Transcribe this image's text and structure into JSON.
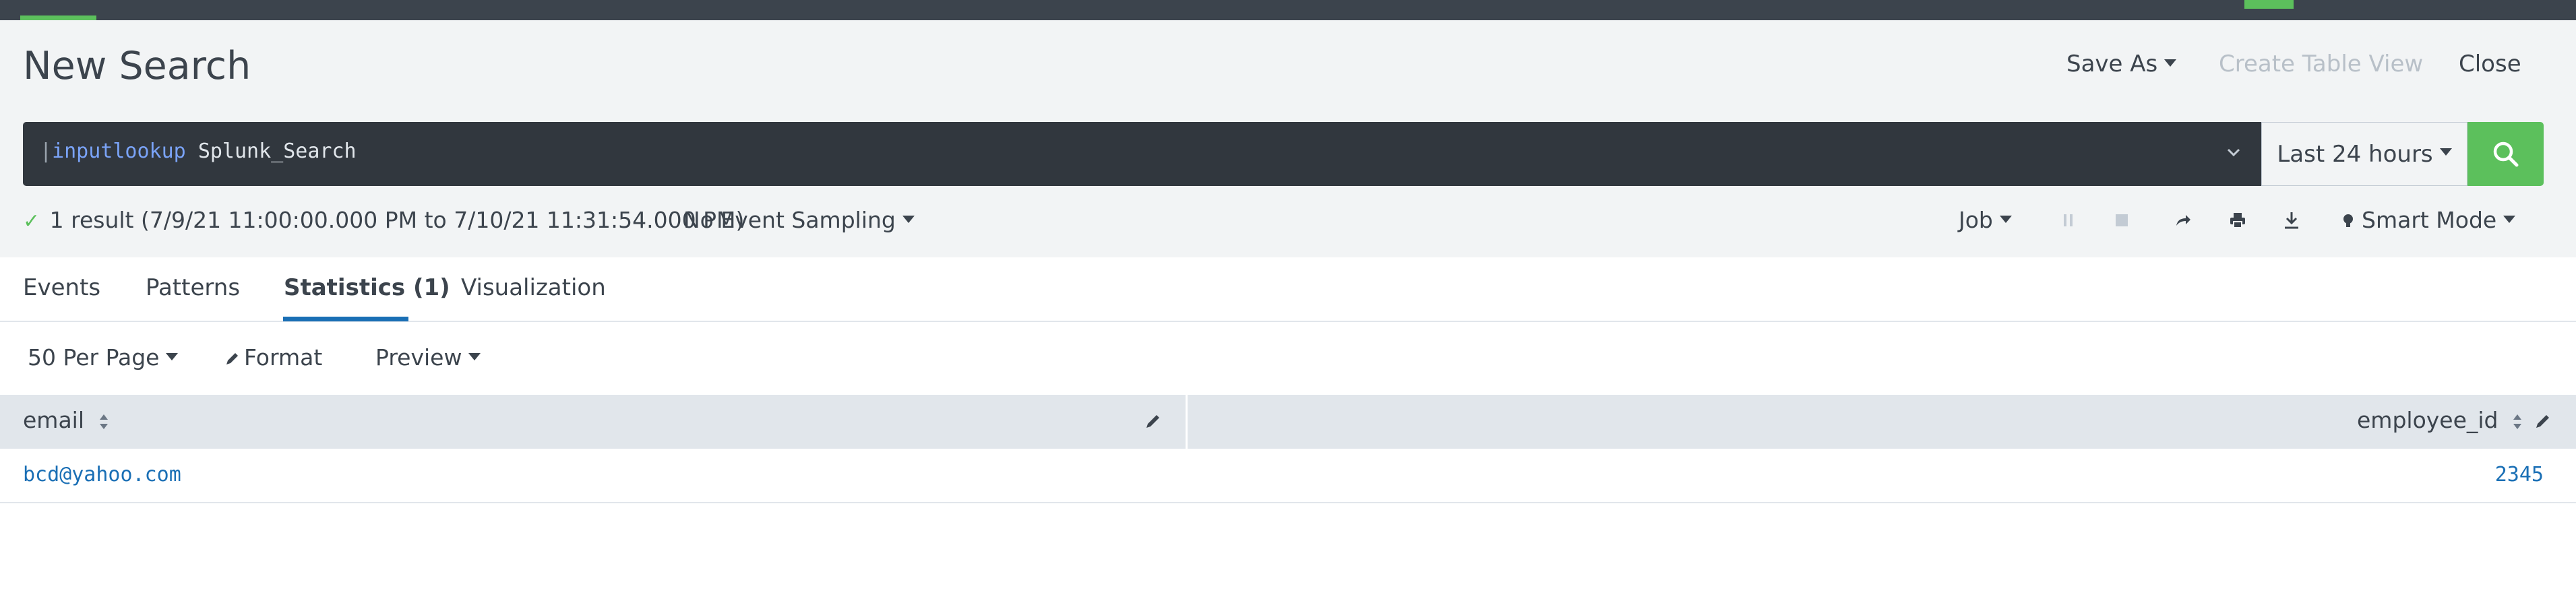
{
  "header": {
    "title": "New Search",
    "save_as": "Save As",
    "create_table_view": "Create Table View",
    "close": "Close"
  },
  "search": {
    "pipe": "|",
    "command": "inputlookup",
    "argument": "Splunk_Search",
    "time_range": "Last 24 hours"
  },
  "status": {
    "result_text": "1 result (7/9/21 11:00:00.000 PM to 7/10/21 11:31:54.000 PM)",
    "sampling": "No Event Sampling",
    "job": "Job",
    "mode": "Smart Mode"
  },
  "tabs": [
    {
      "label": "Events",
      "active": false
    },
    {
      "label": "Patterns",
      "active": false
    },
    {
      "label": "Statistics (1)",
      "active": true
    },
    {
      "label": "Visualization",
      "active": false
    }
  ],
  "table_controls": {
    "per_page": "50 Per Page",
    "format": "Format",
    "preview": "Preview"
  },
  "table": {
    "columns": [
      "email",
      "employee_id"
    ],
    "rows": [
      [
        "bcd@yahoo.com",
        "2345"
      ]
    ]
  },
  "colors": {
    "accent_green": "#5cc05c",
    "link_blue": "#1a6fb5",
    "dark_bar": "#31373e"
  },
  "icons": {
    "search": "search-icon",
    "pause": "pause-icon",
    "stop": "stop-icon",
    "share": "share-icon",
    "print": "print-icon",
    "export": "download-icon",
    "mode": "lightbulb-icon"
  }
}
